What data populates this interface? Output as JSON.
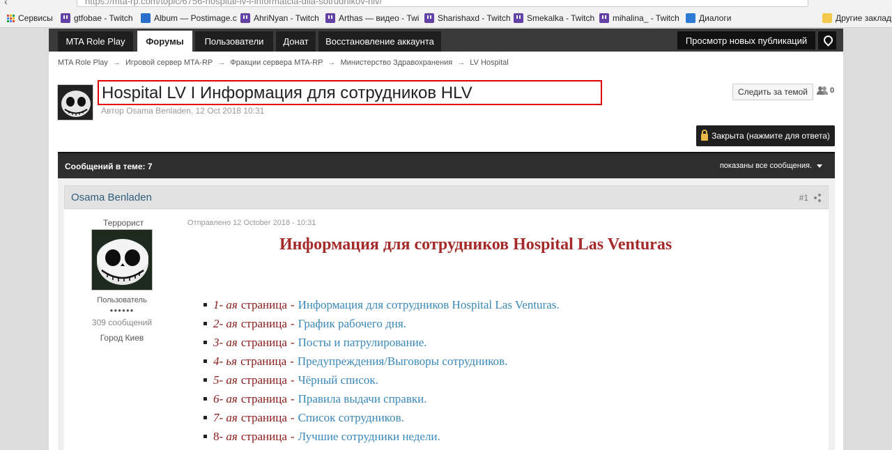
{
  "browser": {
    "url": "https://mta-rp.com/topic/6756-hospital-lv-i-informatcia-dlia-sotrudnikov-hlv/",
    "bookmarks": [
      {
        "label": "Сервисы",
        "icon": "apps-icon"
      },
      {
        "label": "gtfobae - Twitch",
        "icon": "twitch-icon"
      },
      {
        "label": "Album — Postimage.c",
        "icon": "postimage-icon"
      },
      {
        "label": "AhriNyan - Twitch",
        "icon": "twitch-icon"
      },
      {
        "label": "Arthas — видео - Twi",
        "icon": "twitch-icon"
      },
      {
        "label": "Sharishaxd - Twitch",
        "icon": "twitch-icon"
      },
      {
        "label": "Smekalka - Twitch",
        "icon": "twitch-icon"
      },
      {
        "label": "mihalina_ - Twitch",
        "icon": "twitch-icon"
      },
      {
        "label": "Диалоги",
        "icon": "dialog-icon"
      },
      {
        "label": "Другие закладк",
        "icon": "folder-icon"
      }
    ]
  },
  "nav": {
    "tabs": [
      "MTA Role Play",
      "Форумы",
      "Пользователи",
      "Донат",
      "Восстановление аккаунта"
    ],
    "active_tab": "Форумы",
    "right_button": "Просмотр новых публикаций",
    "right_icon": "map-pin-icon"
  },
  "breadcrumb": [
    "MTA Role Play",
    "Игровой сервер MTA-RP",
    "Фракции сервера MTA-RP",
    "Министерство Здравохранения",
    "LV Hospital"
  ],
  "topic": {
    "title": "Hospital LV I Информация для сотрудников HLV",
    "meta": "Автор Osama Benladen, 12 Oct 2018 10:31",
    "follow_label": "Следить за темой",
    "followers_count": "0",
    "locked_label": "Закрыта (нажмите для ответа)"
  },
  "thread_bar": {
    "count_label": "Сообщений в теме: 7",
    "filter_label": "показаны все сообщения."
  },
  "post": {
    "author": "Osama Benladen",
    "number": "#1",
    "rank": "Террорист",
    "group": "Пользователь",
    "pips": "●●●●●●",
    "post_count": "309 сообщений",
    "city": "Город Киев",
    "date": "Отправлено 12 October 2018 - 10:31",
    "heading": "Информация для сотрудников Hospital Las Venturas",
    "items": [
      {
        "num": "1",
        "suffix": " - ая",
        "page": "страница",
        "link": "Информация для сотрудников Hospital Las Venturas."
      },
      {
        "num": "2",
        "suffix": " - ая",
        "page": "страница",
        "link": "График рабочего дня."
      },
      {
        "num": "3",
        "suffix": " - ая",
        "page": "страница",
        "link": "Посты и патрулирование."
      },
      {
        "num": "4",
        "suffix": " - ья",
        "page": "страница",
        "link": "Предупреждения/Выговоры сотрудников."
      },
      {
        "num": "5",
        "suffix": " - ая",
        "page": "страница",
        "link": "Чёрный список."
      },
      {
        "num": "6",
        "suffix": " - ая",
        "page": "страница",
        "link": "Правила выдачи справки."
      },
      {
        "num": "7",
        "suffix": " - ая",
        "page": "страница",
        "link": "Список сотрудников."
      },
      {
        "num": "8",
        "suffix": " - ая",
        "page": "страница",
        "link": "Лучшие сотрудники недели."
      }
    ]
  },
  "colors": {
    "nav_bg": "#3a3a3a",
    "heading": "#a52a2a",
    "link": "#3a88b8",
    "title_highlight": "#e00000"
  }
}
